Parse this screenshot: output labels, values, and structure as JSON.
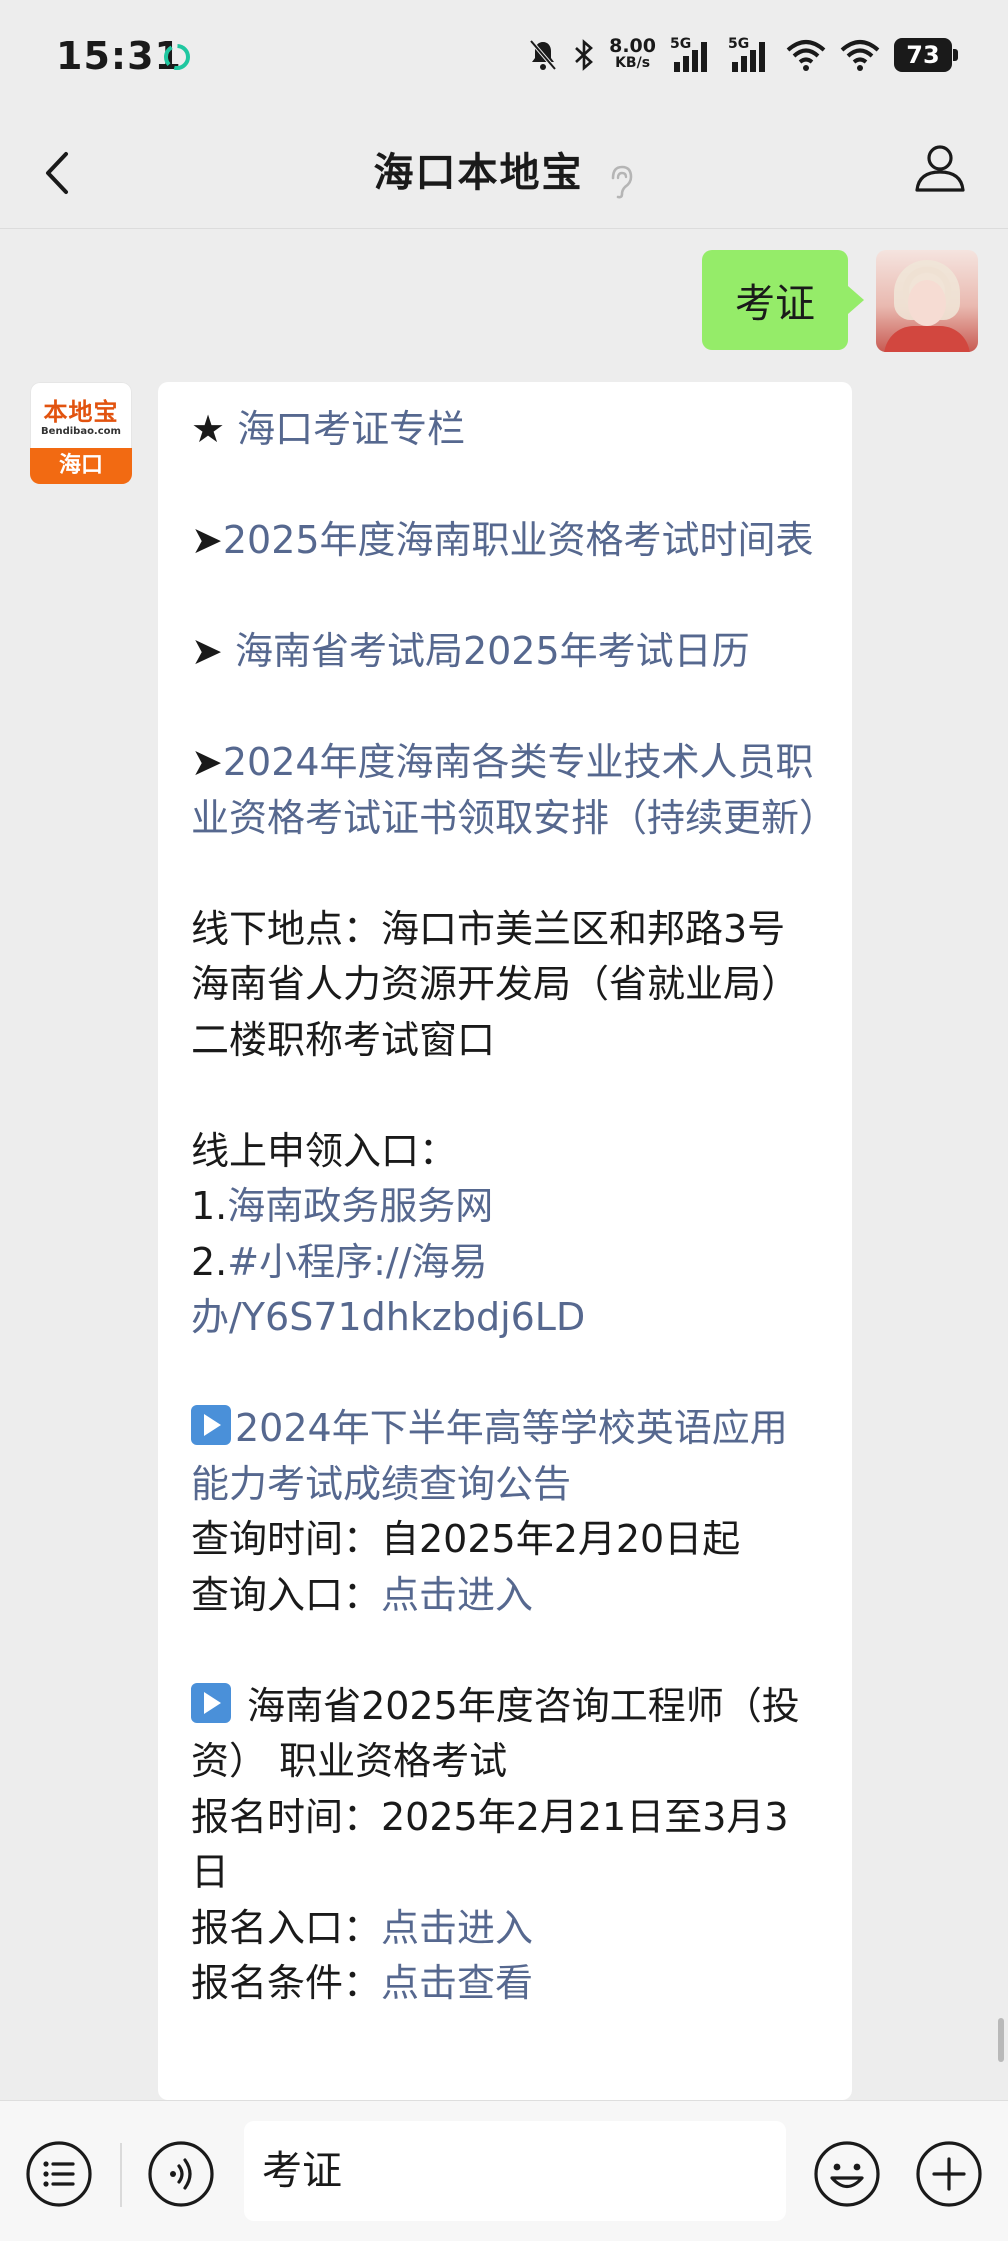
{
  "status_bar": {
    "time": "15:31",
    "net_speed_value": "8.00",
    "net_speed_unit": "KB/s",
    "signal1_label": "5G",
    "signal2_label": "5G",
    "battery": "73"
  },
  "header": {
    "title": "海口本地宝"
  },
  "chat": {
    "user_message": "考证",
    "bot_avatar_logo": "本地宝",
    "bot_avatar_domain": "Bendibao.com",
    "bot_avatar_city": "海口",
    "reply": {
      "l1_star": "★",
      "l1_link": "海口考证专栏",
      "l2_arrow": "➤",
      "l2_link": "2025年度海南职业资格考试时间表",
      "l3_arrow": "➤",
      "l3_link": "海南省考试局2025年考试日历",
      "l4_arrow": "➤",
      "l4_link": "2024年度海南各类专业技术人员职业资格考试证书领取安排（持续更新）",
      "offline_location": "线下地点：海口市美兰区和邦路3号海南省人力资源开发局（省就业局）二楼职称考试窗口",
      "online_header": "线上申领入口：",
      "online_1_num": "1.",
      "online_1_link": "海南政务服务网",
      "online_2_num": "2.",
      "online_2_link": "#小程序://海易办/Y6S71dhkzbdj6LD",
      "s1_link": "2024年下半年高等学校英语应用能力考试成绩查询公告",
      "s1_time": "查询时间：自2025年2月20日起",
      "s1_entry_label": "查询入口：",
      "s1_entry_link": "点击进入",
      "s2_title": " 海南省2025年度咨询工程师（投资） 职业资格考试",
      "s2_time": "报名时间：2025年2月21日至3月3日",
      "s2_entry_label": "报名入口：",
      "s2_entry_link": "点击进入",
      "s2_cond_label": "报名条件：",
      "s2_cond_link": "点击查看"
    }
  },
  "input_bar": {
    "value": "考证"
  },
  "colors": {
    "user_bubble": "#95ec69",
    "link": "#56688f",
    "background": "#ededed",
    "brand_orange": "#f26a12"
  },
  "icons": [
    "clean-icon",
    "mute-icon",
    "bluetooth-icon",
    "signal-icon",
    "wifi-icon",
    "battery-icon",
    "back-icon",
    "ear-icon",
    "user-icon",
    "menu-icon",
    "voice-icon",
    "emoji-icon",
    "plus-icon",
    "play-icon"
  ]
}
